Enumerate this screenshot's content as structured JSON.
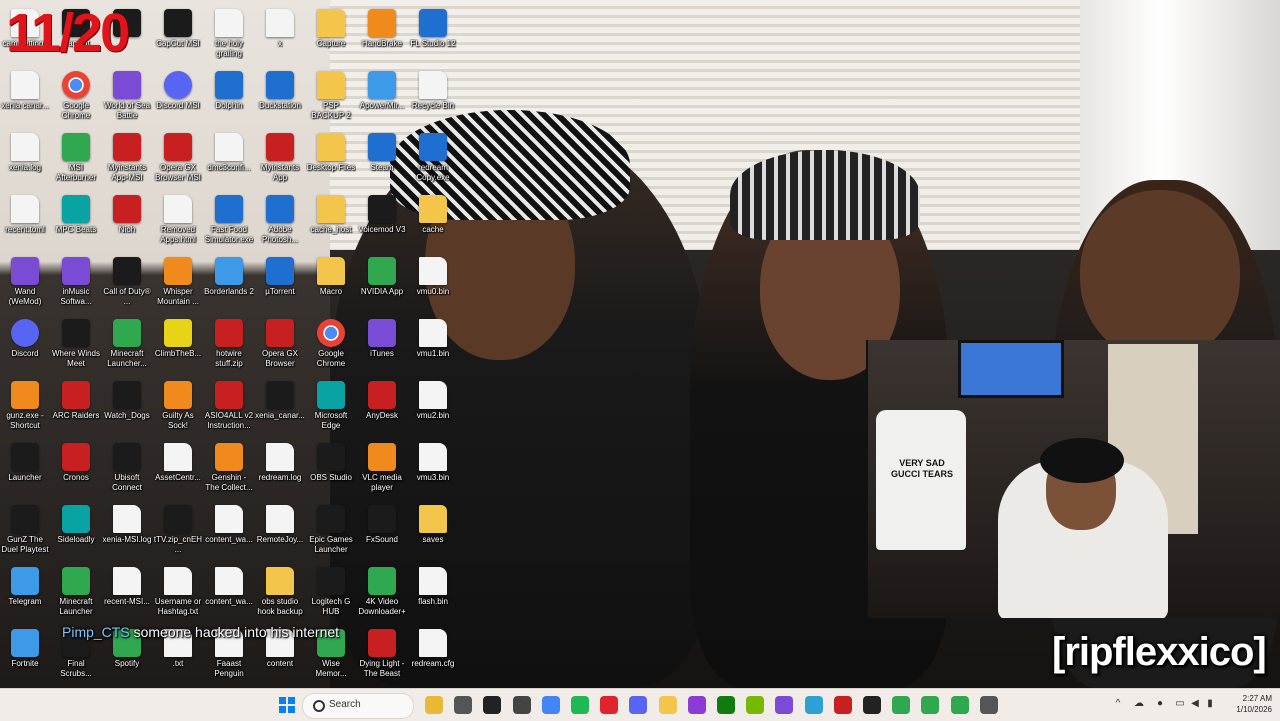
{
  "overlay": {
    "counter": "11/20",
    "caption_handle": "Pimp_CTS",
    "caption_text": "someone hacked into his internet",
    "watermark": "[ripflexxico]"
  },
  "webcam": {
    "shirt_text": "VERY SAD\nGUCCI TEARS"
  },
  "desktop_icons": [
    {
      "label": "cam settings",
      "type": "file"
    },
    {
      "label": "CapCut",
      "type": "dark"
    },
    {
      "label": "",
      "type": "dark"
    },
    {
      "label": "CapCut MSI",
      "type": "dark"
    },
    {
      "label": "the holy grailing",
      "type": "file"
    },
    {
      "label": "x",
      "type": "file"
    },
    {
      "label": "Capture",
      "type": "folder"
    },
    {
      "label": "HandBrake",
      "type": "orange"
    },
    {
      "label": "FL Studio 12",
      "type": "exe"
    },
    {
      "label": "xenia canar...",
      "type": "file"
    },
    {
      "label": "Google Chrome",
      "type": "chrome"
    },
    {
      "label": "World of Sea Battle",
      "type": "purple"
    },
    {
      "label": "Discord MSI",
      "type": "discord"
    },
    {
      "label": "Dolphin",
      "type": "exe"
    },
    {
      "label": "Duckstation",
      "type": "exe"
    },
    {
      "label": "PSP BACKUP 2",
      "type": "folder"
    },
    {
      "label": "ApowerMir...",
      "type": "blue2"
    },
    {
      "label": "Recycle Bin",
      "type": "file"
    },
    {
      "label": "xenia.log",
      "type": "file"
    },
    {
      "label": "MSI Afterburner",
      "type": "green"
    },
    {
      "label": "Myinstants App-MSI",
      "type": "red"
    },
    {
      "label": "Opera GX Browser MSI",
      "type": "red"
    },
    {
      "label": "dmc3confi...",
      "type": "file"
    },
    {
      "label": "Myinstants App",
      "type": "red"
    },
    {
      "label": "Desktop Files",
      "type": "folder"
    },
    {
      "label": "Steam",
      "type": "exe"
    },
    {
      "label": "redream Copy.exe",
      "type": "exe"
    },
    {
      "label": "recent.toml",
      "type": "file"
    },
    {
      "label": "MPC Beats",
      "type": "teal"
    },
    {
      "label": "Nioh",
      "type": "red"
    },
    {
      "label": "Removed Apps.html",
      "type": "file"
    },
    {
      "label": "Fast Food Simulator.exe",
      "type": "exe"
    },
    {
      "label": "Adobe Photosh...",
      "type": "exe"
    },
    {
      "label": "cache_host",
      "type": "folder"
    },
    {
      "label": "Voicemod V3",
      "type": "dark"
    },
    {
      "label": "cache",
      "type": "folder"
    },
    {
      "label": "Wand (WeMod)",
      "type": "purple"
    },
    {
      "label": "inMusic Softwa...",
      "type": "purple"
    },
    {
      "label": "Call of Duty® ...",
      "type": "dark"
    },
    {
      "label": "Whisper Mountain ...",
      "type": "orange"
    },
    {
      "label": "Borderlands 2",
      "type": "blue2"
    },
    {
      "label": "µTorrent",
      "type": "exe"
    },
    {
      "label": "Macro",
      "type": "folder"
    },
    {
      "label": "NVIDIA App",
      "type": "green"
    },
    {
      "label": "vmu0.bin",
      "type": "file"
    },
    {
      "label": "Discord",
      "type": "discord"
    },
    {
      "label": "Where Winds Meet",
      "type": "dark"
    },
    {
      "label": "Minecraft Launcher...",
      "type": "green"
    },
    {
      "label": "ClimbTheB...",
      "type": "yellow"
    },
    {
      "label": "hotwire stuff.zip",
      "type": "red"
    },
    {
      "label": "Opera GX Browser",
      "type": "red"
    },
    {
      "label": "Google Chrome",
      "type": "chrome"
    },
    {
      "label": "iTunes",
      "type": "purple"
    },
    {
      "label": "vmu1.bin",
      "type": "file"
    },
    {
      "label": "gunz.exe - Shortcut",
      "type": "orange"
    },
    {
      "label": "ARC Raiders",
      "type": "red"
    },
    {
      "label": "Watch_Dogs",
      "type": "dark"
    },
    {
      "label": "Guilty As Sock!",
      "type": "orange"
    },
    {
      "label": "ASIO4ALL v2 Instruction...",
      "type": "red"
    },
    {
      "label": "xenia_canar...",
      "type": "dark"
    },
    {
      "label": "Microsoft Edge",
      "type": "teal"
    },
    {
      "label": "AnyDesk",
      "type": "red"
    },
    {
      "label": "vmu2.bin",
      "type": "file"
    },
    {
      "label": "Launcher",
      "type": "dark"
    },
    {
      "label": "Cronos",
      "type": "red"
    },
    {
      "label": "Ubisoft Connect",
      "type": "dark"
    },
    {
      "label": "AssetCentr...",
      "type": "file"
    },
    {
      "label": "Genshin - The Collect...",
      "type": "orange"
    },
    {
      "label": "redream.log",
      "type": "file"
    },
    {
      "label": "OBS Studio",
      "type": "dark"
    },
    {
      "label": "VLC media player",
      "type": "orange"
    },
    {
      "label": "vmu3.bin",
      "type": "file"
    },
    {
      "label": "GunZ The Duel Playtest",
      "type": "dark"
    },
    {
      "label": "Sideloadly",
      "type": "teal"
    },
    {
      "label": "xenia-MSI.log",
      "type": "file"
    },
    {
      "label": "tTV.zip_cnEH...",
      "type": "dark"
    },
    {
      "label": "content_wa...",
      "type": "file"
    },
    {
      "label": "RemoteJoy...",
      "type": "file"
    },
    {
      "label": "Epic Games Launcher",
      "type": "dark"
    },
    {
      "label": "FxSound",
      "type": "dark"
    },
    {
      "label": "saves",
      "type": "folder"
    },
    {
      "label": "Telegram",
      "type": "blue2"
    },
    {
      "label": "Minecraft Launcher",
      "type": "green"
    },
    {
      "label": "recent-MSI...",
      "type": "file"
    },
    {
      "label": "Username or Hashtag.txt",
      "type": "file"
    },
    {
      "label": "content_wa...",
      "type": "file"
    },
    {
      "label": "obs studio hook backup",
      "type": "folder"
    },
    {
      "label": "Logitech G HUB",
      "type": "dark"
    },
    {
      "label": "4K Video Downloader+",
      "type": "green"
    },
    {
      "label": "flash.bin",
      "type": "file"
    },
    {
      "label": "Fortnite",
      "type": "blue2"
    },
    {
      "label": "Final Scrubs...",
      "type": "dark"
    },
    {
      "label": "Spotify",
      "type": "green"
    },
    {
      "label": ".txt",
      "type": "file"
    },
    {
      "label": "Faaast Penguin",
      "type": "file"
    },
    {
      "label": "content",
      "type": "file"
    },
    {
      "label": "Wise Memor...",
      "type": "green"
    },
    {
      "label": "Dying Light - The Beast",
      "type": "red"
    },
    {
      "label": "redream.cfg",
      "type": "file"
    }
  ],
  "taskbar": {
    "search_placeholder": "Search",
    "pinned": [
      {
        "name": "file-explorer-icon",
        "color": "#e8b935"
      },
      {
        "name": "task-view-icon",
        "color": "#555555"
      },
      {
        "name": "capcut-icon",
        "color": "#222222"
      },
      {
        "name": "obs-icon",
        "color": "#444444"
      },
      {
        "name": "chrome-icon",
        "color": "#4285f4"
      },
      {
        "name": "spotify-icon",
        "color": "#1db954"
      },
      {
        "name": "opera-icon",
        "color": "#e0242e"
      },
      {
        "name": "discord-icon",
        "color": "#5865f2"
      },
      {
        "name": "folder-icon",
        "color": "#f3c64b"
      },
      {
        "name": "app-icon",
        "color": "#8a3bd6"
      },
      {
        "name": "xbox-icon",
        "color": "#107c10"
      },
      {
        "name": "nvidia-icon",
        "color": "#76b900"
      },
      {
        "name": "game-icon",
        "color": "#7a4cd6"
      },
      {
        "name": "app-icon",
        "color": "#2ea0d6"
      },
      {
        "name": "record-icon",
        "color": "#c82020"
      },
      {
        "name": "capcut-icon",
        "color": "#222222"
      },
      {
        "name": "app-icon",
        "color": "#2fa84f"
      },
      {
        "name": "app-icon",
        "color": "#2fa84f"
      },
      {
        "name": "app-icon",
        "color": "#2fa84f"
      },
      {
        "name": "grid-icon",
        "color": "#555555"
      }
    ],
    "time": "2:27 AM",
    "date": "1/10/2026"
  }
}
